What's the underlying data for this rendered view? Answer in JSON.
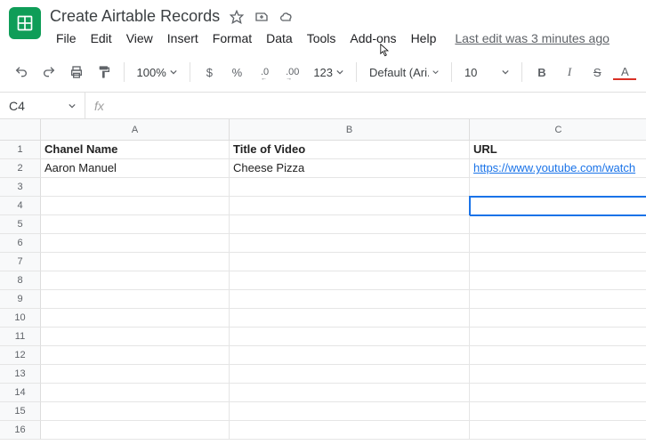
{
  "doc": {
    "title": "Create Airtable Records",
    "last_edit": "Last edit was 3 minutes ago"
  },
  "menu": {
    "file": "File",
    "edit": "Edit",
    "view": "View",
    "insert": "Insert",
    "format": "Format",
    "data": "Data",
    "tools": "Tools",
    "addons": "Add-ons",
    "help": "Help"
  },
  "toolbar": {
    "zoom": "100%",
    "currency": "$",
    "percent": "%",
    "dec_less": ".0",
    "dec_more": ".00",
    "num_format": "123",
    "font": "Default (Ari...",
    "font_size": "10",
    "bold": "B",
    "italic": "I",
    "strike": "S",
    "text_color": "A"
  },
  "formula": {
    "cell_ref": "C4",
    "fx": "fx"
  },
  "columns": {
    "a": "A",
    "b": "B",
    "c": "C"
  },
  "sheet": {
    "header": {
      "a": "Chanel Name",
      "b": "Title of Video",
      "c": "URL"
    },
    "row2": {
      "a": "Aaron Manuel",
      "b": "Cheese Pizza",
      "c": "https://www.youtube.com/watch"
    }
  }
}
